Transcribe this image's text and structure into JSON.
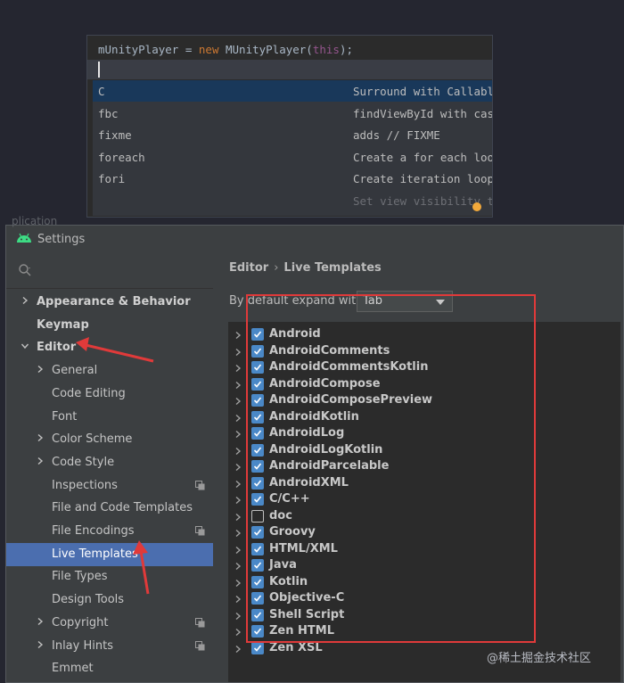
{
  "editor": {
    "code": {
      "variable": "mUnityPlayer",
      "equals": " = ",
      "keyword": "new",
      "class_call": " MUnityPlayer(",
      "this_kw": "this",
      "tail": ");"
    },
    "completions": [
      {
        "abbr": "C",
        "desc": "Surround with Callable"
      },
      {
        "abbr": "fbc",
        "desc": "findViewById with cast"
      },
      {
        "abbr": "fixme",
        "desc": "adds // FIXME"
      },
      {
        "abbr": "foreach",
        "desc": "Create a for each loop"
      },
      {
        "abbr": "fori",
        "desc": "Create iteration loop"
      },
      {
        "abbr": "",
        "desc": "Set view visibility to GONE"
      }
    ],
    "selected_index": 0
  },
  "dialog": {
    "ghost_text": "plication",
    "title": "Settings",
    "sidebar": {
      "items": [
        {
          "label": "Appearance & Behavior",
          "bold": true,
          "chevron": "right"
        },
        {
          "label": "Keymap",
          "bold": true,
          "chevron": ""
        },
        {
          "label": "Editor",
          "bold": true,
          "chevron": "down"
        },
        {
          "label": "General",
          "bold": false,
          "chevron": "right",
          "child": true
        },
        {
          "label": "Code Editing",
          "bold": false,
          "chevron": "",
          "child": true
        },
        {
          "label": "Font",
          "bold": false,
          "chevron": "",
          "child": true
        },
        {
          "label": "Color Scheme",
          "bold": false,
          "chevron": "right",
          "child": true
        },
        {
          "label": "Code Style",
          "bold": false,
          "chevron": "right",
          "child": true
        },
        {
          "label": "Inspections",
          "bold": false,
          "chevron": "",
          "child": true,
          "project_icon": true
        },
        {
          "label": "File and Code Templates",
          "bold": false,
          "chevron": "",
          "child": true
        },
        {
          "label": "File Encodings",
          "bold": false,
          "chevron": "",
          "child": true,
          "project_icon": true
        },
        {
          "label": "Live Templates",
          "bold": false,
          "chevron": "",
          "child": true,
          "selected": true
        },
        {
          "label": "File Types",
          "bold": false,
          "chevron": "",
          "child": true
        },
        {
          "label": "Design Tools",
          "bold": false,
          "chevron": "",
          "child": true
        },
        {
          "label": "Copyright",
          "bold": false,
          "chevron": "right",
          "child": true,
          "project_icon": true
        },
        {
          "label": "Inlay Hints",
          "bold": false,
          "chevron": "right",
          "child": true,
          "project_icon": true
        },
        {
          "label": "Emmet",
          "bold": false,
          "chevron": "",
          "child": true
        }
      ]
    },
    "content": {
      "breadcrumb": {
        "parent": "Editor",
        "separator": "›",
        "current": "Live Templates"
      },
      "expand_label": "By default expand with",
      "expand_value": "Tab",
      "groups": [
        {
          "name": "Android",
          "checked": true
        },
        {
          "name": "AndroidComments",
          "checked": true
        },
        {
          "name": "AndroidCommentsKotlin",
          "checked": true
        },
        {
          "name": "AndroidCompose",
          "checked": true
        },
        {
          "name": "AndroidComposePreview",
          "checked": true
        },
        {
          "name": "AndroidKotlin",
          "checked": true
        },
        {
          "name": "AndroidLog",
          "checked": true
        },
        {
          "name": "AndroidLogKotlin",
          "checked": true
        },
        {
          "name": "AndroidParcelable",
          "checked": true
        },
        {
          "name": "AndroidXML",
          "checked": true
        },
        {
          "name": "C/C++",
          "checked": true
        },
        {
          "name": "doc",
          "checked": false
        },
        {
          "name": "Groovy",
          "checked": true
        },
        {
          "name": "HTML/XML",
          "checked": true
        },
        {
          "name": "Java",
          "checked": true
        },
        {
          "name": "Kotlin",
          "checked": true
        },
        {
          "name": "Objective-C",
          "checked": true
        },
        {
          "name": "Shell Script",
          "checked": true
        },
        {
          "name": "Zen HTML",
          "checked": true
        },
        {
          "name": "Zen XSL",
          "checked": true
        }
      ]
    }
  },
  "watermark": "@稀土掘金技术社区",
  "colors": {
    "accent_selected": "#4b6eaf",
    "checkbox": "#4a88c7",
    "annotation_red": "#e03a3a"
  }
}
